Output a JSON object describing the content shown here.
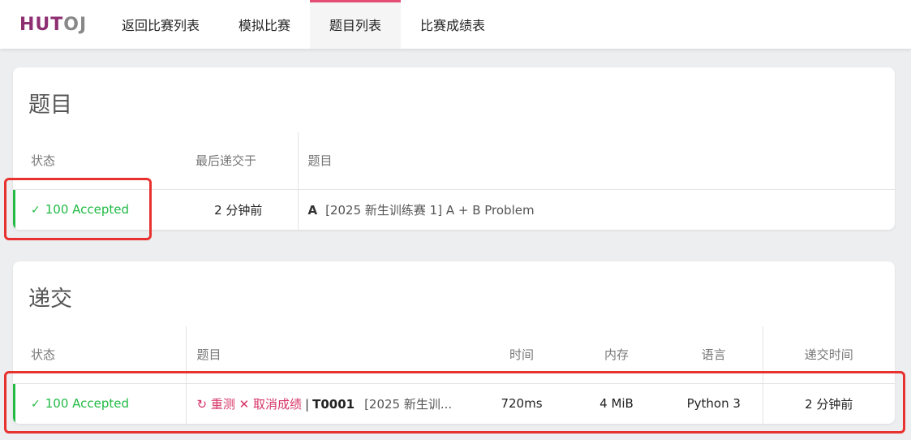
{
  "nav": {
    "logo_a": "HUT",
    "logo_b": "OJ",
    "items": [
      {
        "label": "返回比赛列表"
      },
      {
        "label": "模拟比赛"
      },
      {
        "label": "题目列表"
      },
      {
        "label": "比赛成绩表"
      }
    ],
    "active_index": 2
  },
  "problems": {
    "title": "题目",
    "headers": {
      "status": "状态",
      "last_submit": "最后递交于",
      "problem": "题目"
    },
    "rows": [
      {
        "status_score": "100",
        "status_text": "Accepted",
        "last_submit": "2 分钟前",
        "letter": "A",
        "name": "[2025 新生训练赛 1] A + B Problem"
      }
    ]
  },
  "submissions": {
    "title": "递交",
    "headers": {
      "status": "状态",
      "problem": "题目",
      "time": "时间",
      "memory": "内存",
      "language": "语言",
      "submit_time": "递交时间"
    },
    "rows": [
      {
        "status_score": "100",
        "status_text": "Accepted",
        "rejudge": "重测",
        "cancel": "取消成绩",
        "pid": "T0001",
        "ptitle": "[2025 新生训...",
        "time": "720ms",
        "memory": "4 MiB",
        "language": "Python 3",
        "submit_time": "2 分钟前"
      }
    ]
  },
  "colors": {
    "accent": "#e34d74",
    "accepted": "#21ba45",
    "logo": "#8e2f72",
    "highlight": "#e8322f"
  }
}
